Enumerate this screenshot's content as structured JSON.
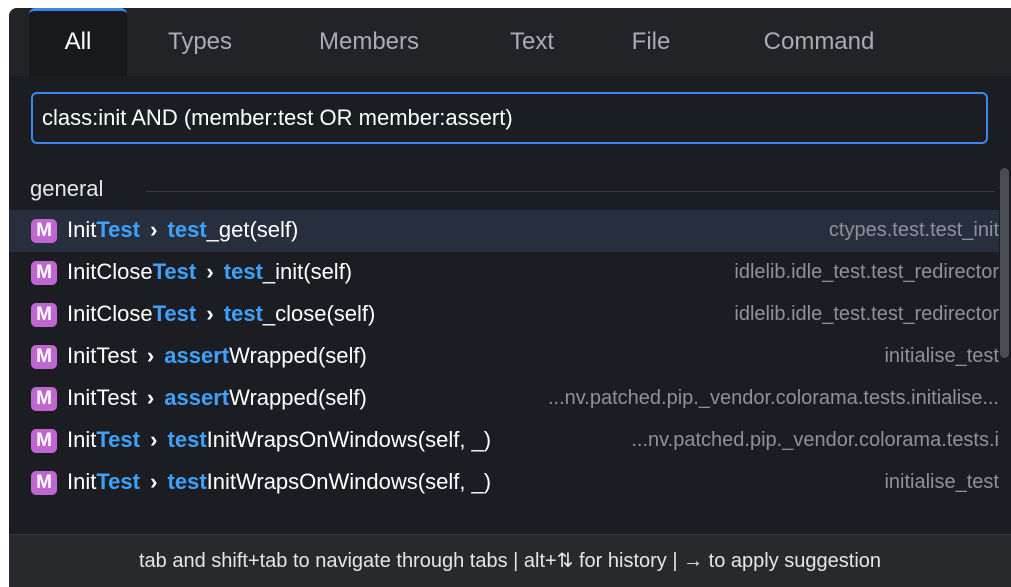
{
  "tabs": [
    {
      "label": "All",
      "active": true
    },
    {
      "label": "Types"
    },
    {
      "label": "Members"
    },
    {
      "label": "Text"
    },
    {
      "label": "File"
    },
    {
      "label": "Command"
    }
  ],
  "search": {
    "value": "class:init AND (member:test OR member:assert)"
  },
  "group": {
    "label": "general"
  },
  "rows": [
    {
      "badge": "M",
      "parts": [
        [
          "Init",
          ""
        ],
        [
          "Test",
          "hl"
        ],
        [
          " › ",
          "chev"
        ],
        [
          "test",
          "hl"
        ],
        [
          "_get(self)",
          ""
        ]
      ],
      "location": "ctypes.test.test_init",
      "selected": true
    },
    {
      "badge": "M",
      "parts": [
        [
          "InitClose",
          ""
        ],
        [
          "Test",
          "hl"
        ],
        [
          " › ",
          "chev"
        ],
        [
          "test",
          "hl"
        ],
        [
          "_init(self)",
          ""
        ]
      ],
      "location": "idlelib.idle_test.test_redirector"
    },
    {
      "badge": "M",
      "parts": [
        [
          "InitClose",
          ""
        ],
        [
          "Test",
          "hl"
        ],
        [
          " › ",
          "chev"
        ],
        [
          "test",
          "hl"
        ],
        [
          "_close(self)",
          ""
        ]
      ],
      "location": "idlelib.idle_test.test_redirector"
    },
    {
      "badge": "M",
      "parts": [
        [
          "InitTest",
          ""
        ],
        [
          " › ",
          "chev"
        ],
        [
          "assert",
          "hl"
        ],
        [
          "Wrapped(self)",
          ""
        ]
      ],
      "location": "initialise_test"
    },
    {
      "badge": "M",
      "parts": [
        [
          "InitTest",
          ""
        ],
        [
          " › ",
          "chev"
        ],
        [
          "assert",
          "hl"
        ],
        [
          "Wrapped(self)",
          ""
        ]
      ],
      "location": "...nv.patched.pip._vendor.colorama.tests.initialise..."
    },
    {
      "badge": "M",
      "parts": [
        [
          "Init",
          ""
        ],
        [
          "Test",
          "hl"
        ],
        [
          " › ",
          "chev"
        ],
        [
          "test",
          "hl"
        ],
        [
          "InitWrapsOnWindows(self, _)",
          ""
        ]
      ],
      "location": "...nv.patched.pip._vendor.colorama.tests.i"
    },
    {
      "badge": "M",
      "parts": [
        [
          "Init",
          ""
        ],
        [
          "Test",
          "hl"
        ],
        [
          " › ",
          "chev"
        ],
        [
          "test",
          "hl"
        ],
        [
          "InitWrapsOnWindows(self, _)",
          ""
        ]
      ],
      "location": "initialise_test"
    }
  ],
  "footer": {
    "text": "tab and shift+tab to navigate through tabs  |  alt+⇅ for history  |  → to apply suggestion"
  },
  "colors": {
    "accent": "#3d86f0",
    "highlight": "#3fa2ff",
    "badge": "#c066d0",
    "background": "#1b1d22"
  }
}
